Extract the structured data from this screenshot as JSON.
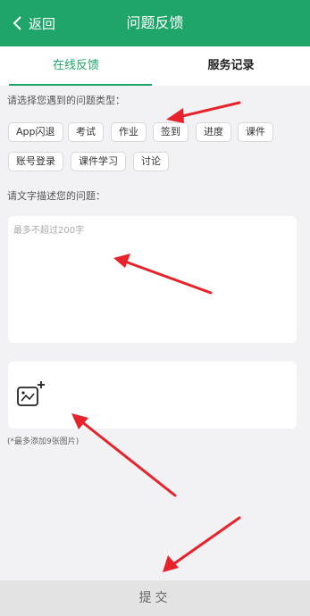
{
  "header": {
    "back_label": "返回",
    "title": "问题反馈",
    "color": "#1fa56a"
  },
  "tabs": [
    {
      "label": "在线反馈",
      "active": true
    },
    {
      "label": "服务记录",
      "active": false
    }
  ],
  "form": {
    "type_label": "请选择您遇到的问题类型：",
    "categories": [
      "App闪退",
      "考试",
      "作业",
      "签到",
      "进度",
      "课件",
      "账号登录",
      "课件学习",
      "讨论"
    ],
    "description_label": "请文字描述您的问题：",
    "description_placeholder": "最多不超过200字",
    "image_hint": "(*最多添加9张图片)"
  },
  "submit_label": "提交",
  "annotation_color": "#e8222b"
}
